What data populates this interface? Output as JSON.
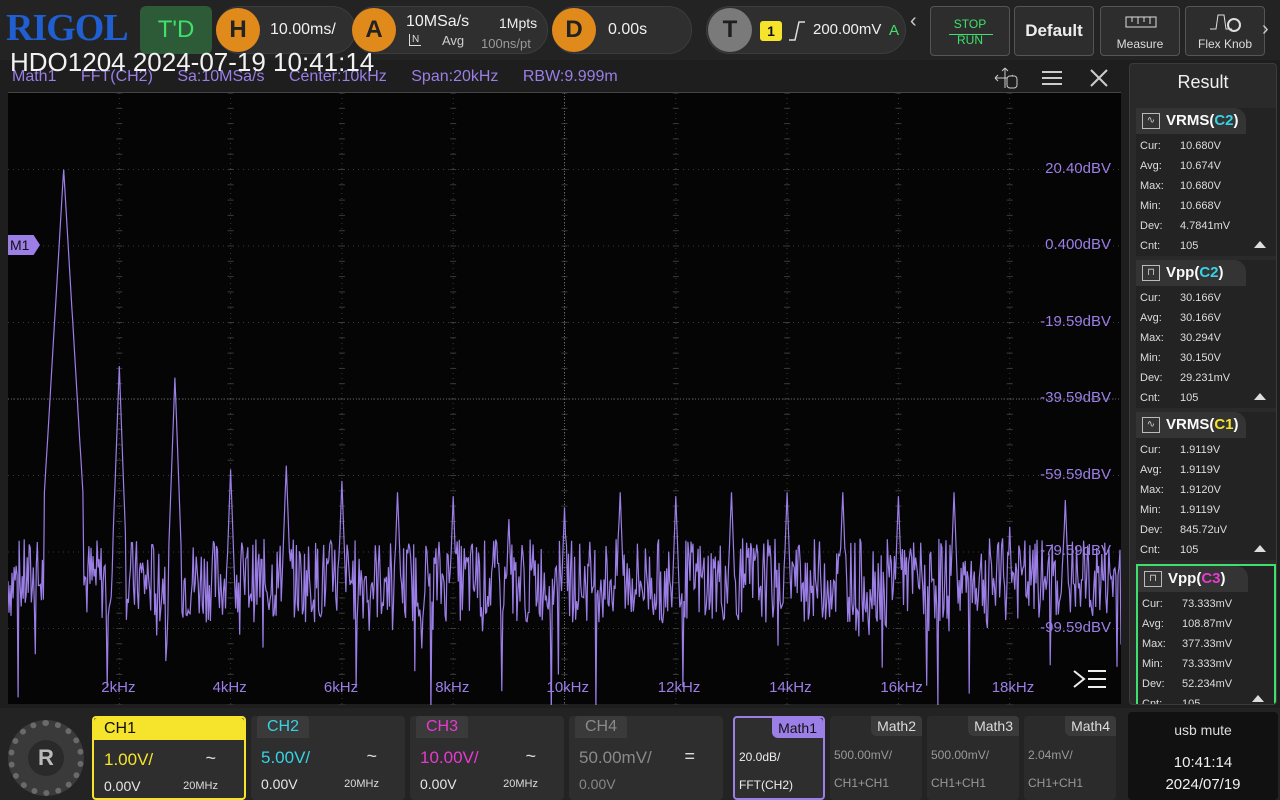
{
  "brand": "RIGOL",
  "timestamp_overlay": "HDO1204 2024-07-19 10:41:14",
  "trigger_status": "T'D",
  "horizontal": {
    "label": "H",
    "scale": "10.00ms/"
  },
  "acquire": {
    "label": "A",
    "sample_rate": "10MSa/s",
    "mode": "Avg",
    "mode_icon": "N",
    "depth": "1Mpts",
    "interval": "100ns/pt"
  },
  "delay": {
    "label": "D",
    "value": "0.00s"
  },
  "trigger": {
    "label": "T",
    "source": "1",
    "level": "200.00mV",
    "mode": "A"
  },
  "buttons": {
    "stop": "STOP",
    "run": "RUN",
    "default": "Default",
    "measure": "Measure",
    "flex_knob": "Flex Knob"
  },
  "info_line": {
    "math": "Math1",
    "op": "FFT(CH2)",
    "sa": "Sa:10MSa/s",
    "center": "Center:10kHz",
    "span": "Span:20kHz",
    "rbw": "RBW:9.999m"
  },
  "math_marker": "M1",
  "chart_data": {
    "type": "line",
    "title": "",
    "y_axis_ticks": [
      "20.40dBV",
      "0.400dBV",
      "-19.59dBV",
      "-39.59dBV",
      "-59.59dBV",
      "-79.59dBV",
      "-99.59dBV"
    ],
    "x_axis_ticks": [
      "2kHz",
      "4kHz",
      "6kHz",
      "8kHz",
      "10kHz",
      "12kHz",
      "14kHz",
      "16kHz",
      "18kHz"
    ],
    "xlim_khz": [
      0,
      20
    ],
    "ylim_dbv": [
      -119.6,
      40.4
    ],
    "noise_floor_dbv": -87,
    "grid": true,
    "series": [
      {
        "color": "#9b7ee6",
        "peaks": [
          {
            "f_khz": 1.0,
            "dbv": 20.4
          },
          {
            "f_khz": 2.0,
            "dbv": -31.0
          },
          {
            "f_khz": 3.0,
            "dbv": -34.0
          },
          {
            "f_khz": 4.0,
            "dbv": -58.0
          },
          {
            "f_khz": 5.0,
            "dbv": -57.0
          },
          {
            "f_khz": 6.0,
            "dbv": -61.0
          },
          {
            "f_khz": 7.0,
            "dbv": -64.0
          },
          {
            "f_khz": 8.0,
            "dbv": -65.0
          },
          {
            "f_khz": 9.0,
            "dbv": -71.0
          },
          {
            "f_khz": 10.0,
            "dbv": -68.0
          },
          {
            "f_khz": 11.0,
            "dbv": -64.0
          },
          {
            "f_khz": 12.0,
            "dbv": -65.0
          },
          {
            "f_khz": 13.0,
            "dbv": -64.0
          },
          {
            "f_khz": 14.0,
            "dbv": -64.0
          },
          {
            "f_khz": 15.0,
            "dbv": -64.0
          },
          {
            "f_khz": 16.0,
            "dbv": -65.0
          },
          {
            "f_khz": 17.0,
            "dbv": -64.0
          },
          {
            "f_khz": 18.0,
            "dbv": -73.0
          },
          {
            "f_khz": 19.0,
            "dbv": -66.0
          }
        ]
      }
    ]
  },
  "result_panel": {
    "title": "Result",
    "measurements": [
      {
        "name": "VRMS(",
        "src": "C2",
        "src_color": "#36d3e6",
        "icon": "rms",
        "rows": [
          [
            "Cur:",
            "10.680V"
          ],
          [
            "Avg:",
            "10.674V"
          ],
          [
            "Max:",
            "10.680V"
          ],
          [
            "Min:",
            "10.668V"
          ],
          [
            "Dev:",
            "4.7841mV"
          ],
          [
            "Cnt:",
            "105"
          ]
        ]
      },
      {
        "name": "Vpp(",
        "src": "C2",
        "src_color": "#36d3e6",
        "icon": "pp",
        "rows": [
          [
            "Cur:",
            "30.166V"
          ],
          [
            "Avg:",
            "30.166V"
          ],
          [
            "Max:",
            "30.294V"
          ],
          [
            "Min:",
            "30.150V"
          ],
          [
            "Dev:",
            "29.231mV"
          ],
          [
            "Cnt:",
            "105"
          ]
        ]
      },
      {
        "name": "VRMS(",
        "src": "C1",
        "src_color": "#f5e42b",
        "icon": "rms",
        "rows": [
          [
            "Cur:",
            "1.9119V"
          ],
          [
            "Avg:",
            "1.9119V"
          ],
          [
            "Max:",
            "1.9120V"
          ],
          [
            "Min:",
            "1.9119V"
          ],
          [
            "Dev:",
            "845.72uV"
          ],
          [
            "Cnt:",
            "105"
          ]
        ]
      },
      {
        "name": "Vpp(",
        "src": "C3",
        "src_color": "#e83ad0",
        "icon": "pp",
        "rows": [
          [
            "Cur:",
            "73.333mV"
          ],
          [
            "Avg:",
            "108.87mV"
          ],
          [
            "Max:",
            "377.33mV"
          ],
          [
            "Min:",
            "73.333mV"
          ],
          [
            "Dev:",
            "52.234mV"
          ],
          [
            "Cnt:",
            "105"
          ]
        ]
      }
    ]
  },
  "channels": [
    {
      "label": "CH1",
      "scale": "1.00V/",
      "offset": "0.00V",
      "bw": "20MHz",
      "coupling": "~",
      "color": "#f5e42b"
    },
    {
      "label": "CH2",
      "scale": "5.00V/",
      "offset": "0.00V",
      "bw": "20MHz",
      "coupling": "~",
      "color": "#36d3e6"
    },
    {
      "label": "CH3",
      "scale": "10.00V/",
      "offset": "0.00V",
      "bw": "20MHz",
      "coupling": "~",
      "color": "#e83ad0"
    },
    {
      "label": "CH4",
      "scale": "50.00mV/",
      "offset": "0.00V",
      "bw": "",
      "coupling": "=",
      "color": "#8a8a8a"
    }
  ],
  "maths": [
    {
      "label": "Math1",
      "line1": "20.0dB/",
      "line2": "FFT(CH2)"
    },
    {
      "label": "Math2",
      "line1": "500.00mV/",
      "line2": "CH1+CH1"
    },
    {
      "label": "Math3",
      "line1": "500.00mV/",
      "line2": "CH1+CH1"
    },
    {
      "label": "Math4",
      "line1": "2.04mV/",
      "line2": "CH1+CH1"
    }
  ],
  "clock": {
    "time": "10:41:14",
    "date": "2024/07/19",
    "icons": "usb  mute"
  }
}
